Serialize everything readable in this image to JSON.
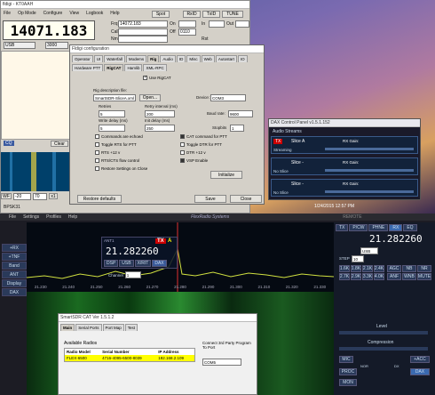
{
  "fldigi": {
    "title": "fldigi - KT0AAH",
    "menu": [
      "File",
      "Op Mode",
      "Configure",
      "View",
      "Logbook",
      "Help"
    ],
    "right_buttons": [
      "Spot",
      "RxID",
      "TxID",
      "TUNE"
    ],
    "frequency": "14071.183",
    "frq_label": "Frq",
    "frq_value": "14072.183",
    "on_label": "On",
    "off_label": "Off",
    "off_value": "0110",
    "in_label": "In",
    "out_label": "Out",
    "call_label": "Call",
    "mode": "USB",
    "filter": "3000",
    "nm_label": "Nm",
    "rst_label": "Rst",
    "cq_label": "CQ",
    "clear_label": "Clear",
    "bottom_labels": [
      "WF",
      "-20",
      "70",
      "x1"
    ],
    "status": "BPSK31"
  },
  "rigcfg": {
    "title": "Fldigi configuration",
    "tabs_row1": [
      "Operator",
      "UI",
      "Waterfall",
      "Modems",
      "Rig",
      "Audio",
      "ID",
      "Misc",
      "Web",
      "Autostart",
      "IO"
    ],
    "tabs_row2": [
      "Hardware PTT",
      "RigCAT",
      "Hamlib",
      "XML-RPC"
    ],
    "use_rigcat": "Use RigCAT",
    "rig_desc_label": "Rig description file:",
    "rig_desc_value": "SmartSDR-SliceA.xml",
    "open_label": "Open...",
    "device_label": "Device:",
    "device_value": "COM3",
    "retries_label": "Retries",
    "retries_value": "5",
    "retry_interval_label": "Retry interval (ms)",
    "retry_interval_value": "200",
    "baud_label": "Baud rate:",
    "baud_value": "9600",
    "write_delay_label": "Write delay (ms)",
    "write_delay_value": "5",
    "init_delay_label": "Init delay (ms)",
    "init_delay_value": "250",
    "stopbits_label": "Stopbits",
    "stopbits_value": "1",
    "options_left": [
      "Commands are echoed",
      "Toggle RTS for PTT",
      "RTS +12 v",
      "RTS/CTS flow control",
      "Restore Settings on Close"
    ],
    "options_right": [
      "CAT command for PTT",
      "Toggle DTR for PTT",
      "DTR +12 v",
      "VSP Enable"
    ],
    "initialize_label": "Initialize",
    "restore_defaults": "Restore defaults",
    "save": "Save",
    "close": "Close"
  },
  "dax": {
    "title": "DAX Control Panel v1.5.1.152",
    "header": "Audio Streams",
    "slices": [
      {
        "label": "Slice A",
        "tx": "TX",
        "name": "Streaming",
        "gain": "RX Gain:"
      },
      {
        "label": "Slice -",
        "tx": "",
        "name": "No Slice",
        "gain": "RX Gain:"
      },
      {
        "label": "Slice -",
        "tx": "",
        "name": "No Slice",
        "gain": "RX Gain:"
      }
    ]
  },
  "clock": "1/24/2015 12:57 PM",
  "flex": {
    "menu": [
      "File",
      "Settings",
      "Profiles",
      "Help"
    ],
    "brand": "FlexRadio Systems",
    "remote": "REMOTE",
    "side_buttons": [
      "+RX",
      "+TNF",
      "Band",
      "ANT",
      "Display",
      "DAX"
    ],
    "slice_freq": "21.282260",
    "ant1": "ANT1",
    "tx_badge": "TX",
    "slice_a": "A",
    "slice_buttons": [
      "DSP",
      "USB",
      "X/RIT",
      "DAX"
    ],
    "channel_label": "Channel",
    "channel_value": "1",
    "freq_axis": [
      "21.230",
      "21.240",
      "21.250",
      "21.260",
      "21.270",
      "21.280",
      "21.290",
      "21.300",
      "21.310",
      "21.320",
      "21.330"
    ],
    "right_tabs": [
      "TX",
      "P/CW",
      "PHNE",
      "RX",
      "EQ"
    ],
    "right_freq": "21.282260",
    "right_mode": "USB",
    "step_label": "STEP",
    "step_value": "10",
    "filters": [
      "1.6K",
      "1.8K",
      "2.1K",
      "2.4K",
      "2.7K",
      "2.9K",
      "3.3K",
      "4.0K"
    ],
    "right_btns": [
      "AGC",
      "NB",
      "NR",
      "ANF",
      "WNB",
      "MUTE"
    ],
    "level_label": "Level",
    "compression_label": "Compression",
    "mic_label": "MIC",
    "acc_label": "+ACC",
    "proc_label": "PROC",
    "mon_label": "MON",
    "dax_label": "DAX",
    "nor_label": "NOR",
    "dx_label": "DX"
  },
  "smartcat": {
    "title": "SmartSDR CAT Ver 1.5.1.2",
    "tabs": [
      "Main",
      "Serial Ports",
      "Port Map",
      "Test"
    ],
    "available_label": "Available Radios",
    "headers": [
      "Radio Model",
      "Serial Number",
      "IP Address"
    ],
    "row": [
      "FLEX-6500",
      "4716-4095-6500-8039",
      "192.168.2.109"
    ],
    "connect_label": "Connect 3rd Party Program To Port",
    "port_value": "COM5"
  }
}
